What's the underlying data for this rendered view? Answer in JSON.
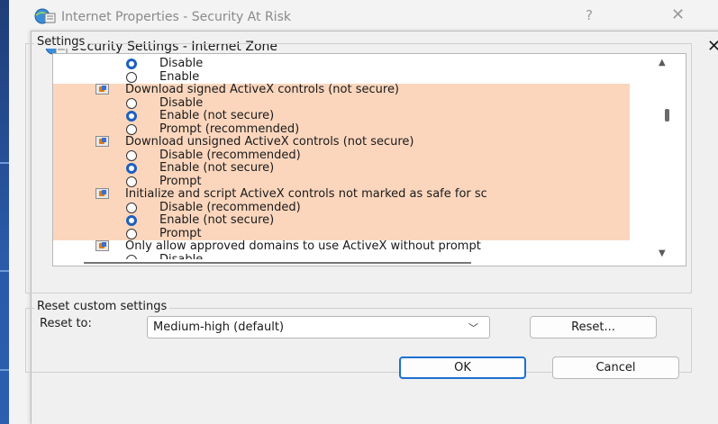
{
  "parent_window": {
    "title": "Internet Properties - Security At Risk",
    "help_glyph": "?",
    "close_glyph": "✕"
  },
  "dialog": {
    "title": "Security Settings - Internet Zone",
    "close_glyph": "✕"
  },
  "settings": {
    "legend": "Settings",
    "rows": [
      {
        "kind": "option",
        "label": "Disable",
        "checked": true,
        "highlight": false
      },
      {
        "kind": "option",
        "label": "Enable",
        "checked": false,
        "highlight": false
      },
      {
        "kind": "heading",
        "label": "Download signed ActiveX controls (not secure)",
        "highlight": true
      },
      {
        "kind": "option",
        "label": "Disable",
        "checked": false,
        "highlight": true
      },
      {
        "kind": "option",
        "label": "Enable (not secure)",
        "checked": true,
        "highlight": true
      },
      {
        "kind": "option",
        "label": "Prompt (recommended)",
        "checked": false,
        "highlight": true
      },
      {
        "kind": "heading",
        "label": "Download unsigned ActiveX controls (not secure)",
        "highlight": true
      },
      {
        "kind": "option",
        "label": "Disable (recommended)",
        "checked": false,
        "highlight": true
      },
      {
        "kind": "option",
        "label": "Enable (not secure)",
        "checked": true,
        "highlight": true
      },
      {
        "kind": "option",
        "label": "Prompt",
        "checked": false,
        "highlight": true
      },
      {
        "kind": "heading",
        "label": "Initialize and script ActiveX controls not marked as safe for sc",
        "highlight": true
      },
      {
        "kind": "option",
        "label": "Disable (recommended)",
        "checked": false,
        "highlight": true
      },
      {
        "kind": "option",
        "label": "Enable (not secure)",
        "checked": true,
        "highlight": true
      },
      {
        "kind": "option",
        "label": "Prompt",
        "checked": false,
        "highlight": true
      },
      {
        "kind": "heading",
        "label": "Only allow approved domains to use ActiveX without prompt",
        "highlight": false
      },
      {
        "kind": "option",
        "label": "Disable",
        "checked": false,
        "highlight": false
      }
    ]
  },
  "reset": {
    "legend": "Reset custom settings",
    "reset_to_label": "Reset to:",
    "selected": "Medium-high (default)",
    "reset_button": "Reset...",
    "ok_button": "OK",
    "cancel_button": "Cancel"
  },
  "colors": {
    "highlight": "#fbd6bd",
    "radio_checked": "#1e5fbf",
    "ok_border": "#1e6fd0"
  },
  "icons": {
    "app": "internet-globe-icon",
    "setting": "activex-setting-icon",
    "combo": "chevron-down-icon",
    "scroll_up": "scroll-up-arrow-icon",
    "scroll_down": "scroll-down-arrow-icon"
  }
}
